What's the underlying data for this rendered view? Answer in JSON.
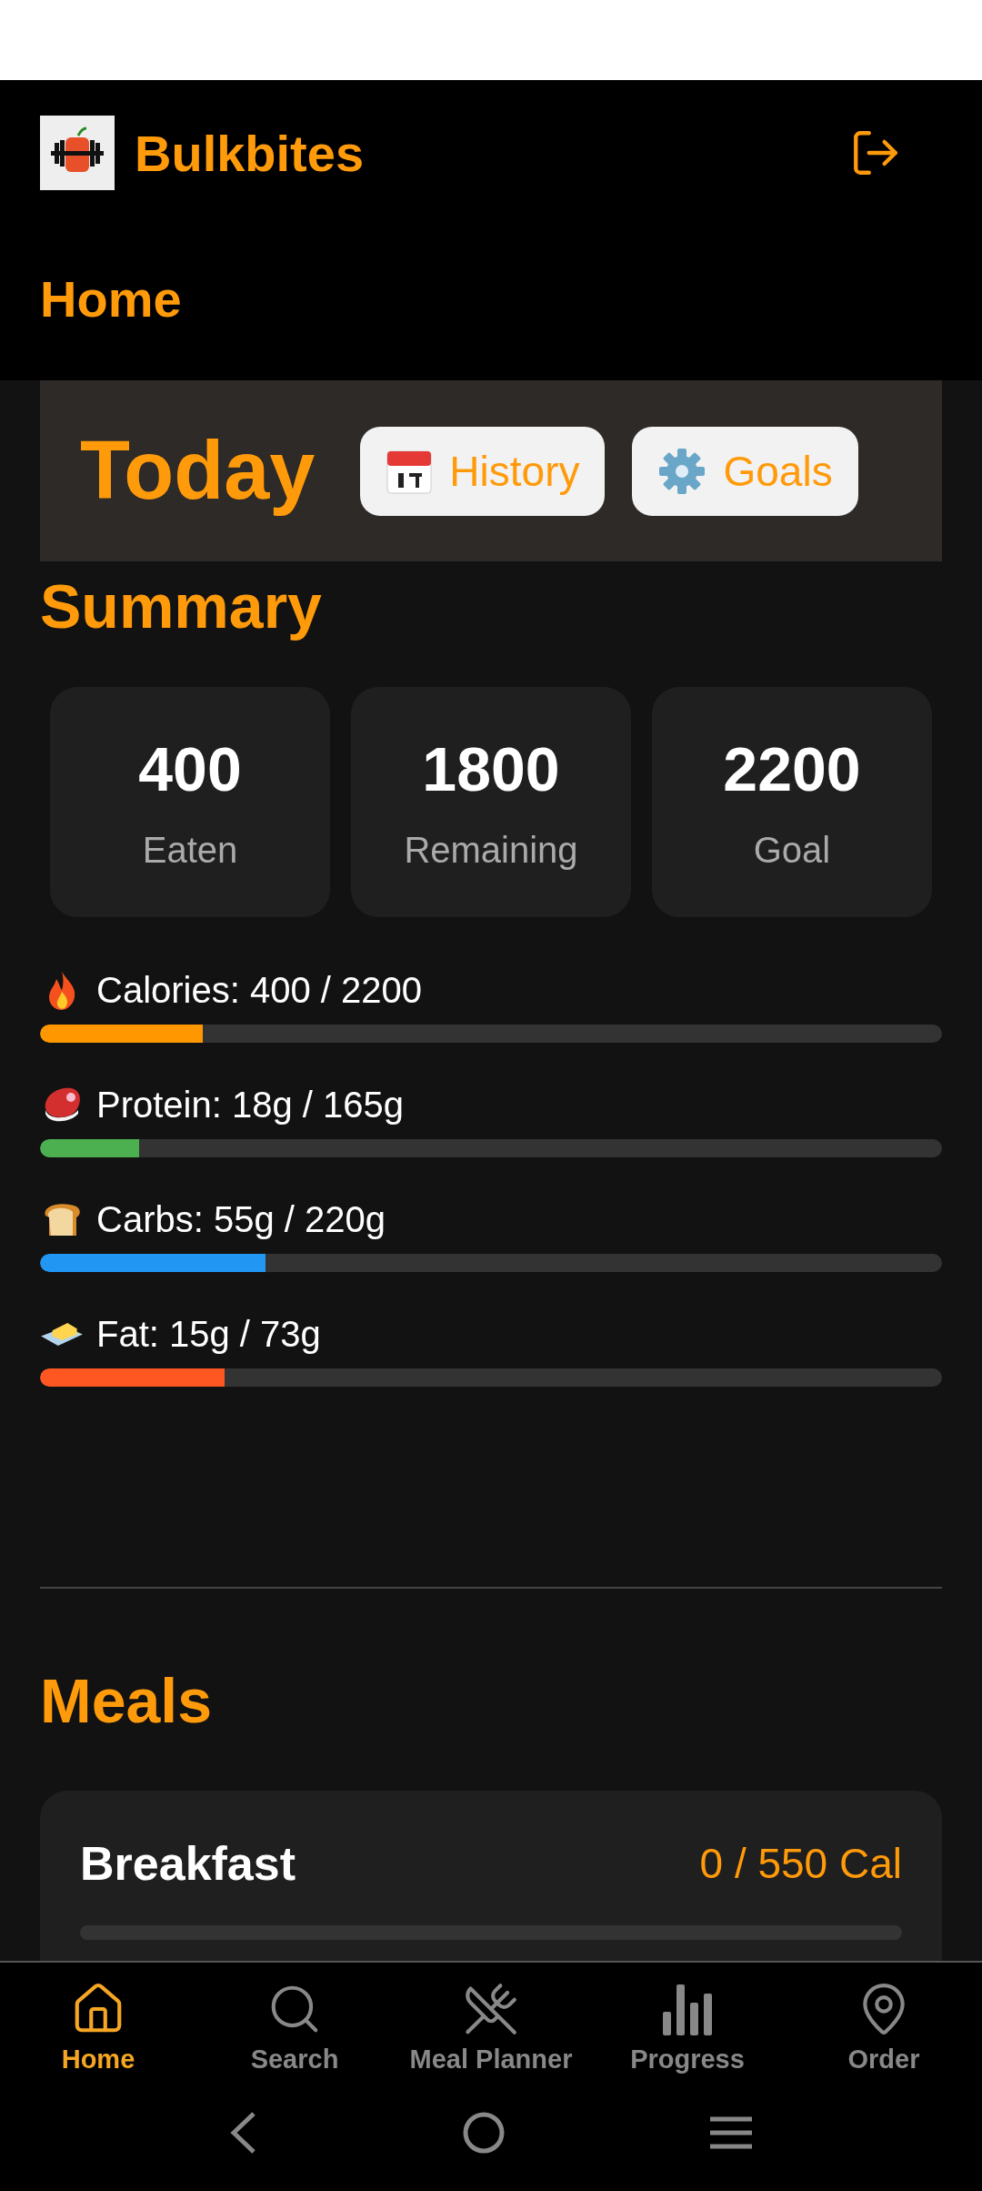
{
  "app": {
    "name": "Bulkbites"
  },
  "page_title": "Home",
  "today": {
    "title": "Today",
    "buttons": [
      {
        "kind": "history",
        "label": "History"
      },
      {
        "kind": "goals",
        "label": "Goals"
      }
    ]
  },
  "summary": {
    "title": "Summary",
    "stats": [
      {
        "value": "400",
        "label": "Eaten"
      },
      {
        "value": "1800",
        "label": "Remaining"
      },
      {
        "value": "2200",
        "label": "Goal"
      }
    ]
  },
  "nutrients": [
    {
      "kind": "calories",
      "label": "Calories: 400 / 2200",
      "level": 0.18,
      "color": "#ff9800"
    },
    {
      "kind": "protein",
      "label": "Protein: 18g / 165g",
      "level": 0.11,
      "color": "#4caf50"
    },
    {
      "kind": "carbs",
      "label": "Carbs: 55g / 220g",
      "level": 0.25,
      "color": "#2196f3"
    },
    {
      "kind": "fat",
      "label": "Fat: 15g / 73g",
      "level": 0.205,
      "color": "#ff5722"
    }
  ],
  "meals": {
    "title": "Meals",
    "items": [
      {
        "name": "Breakfast",
        "calories": "0 / 550 Cal"
      }
    ]
  },
  "nav": [
    {
      "kind": "home",
      "label": "Home",
      "selected": true
    },
    {
      "kind": "search",
      "label": "Search",
      "selected": false
    },
    {
      "kind": "planner",
      "label": "Meal Planner",
      "selected": false
    },
    {
      "kind": "progress",
      "label": "Progress",
      "selected": false
    },
    {
      "kind": "order",
      "label": "Order",
      "selected": false
    }
  ]
}
